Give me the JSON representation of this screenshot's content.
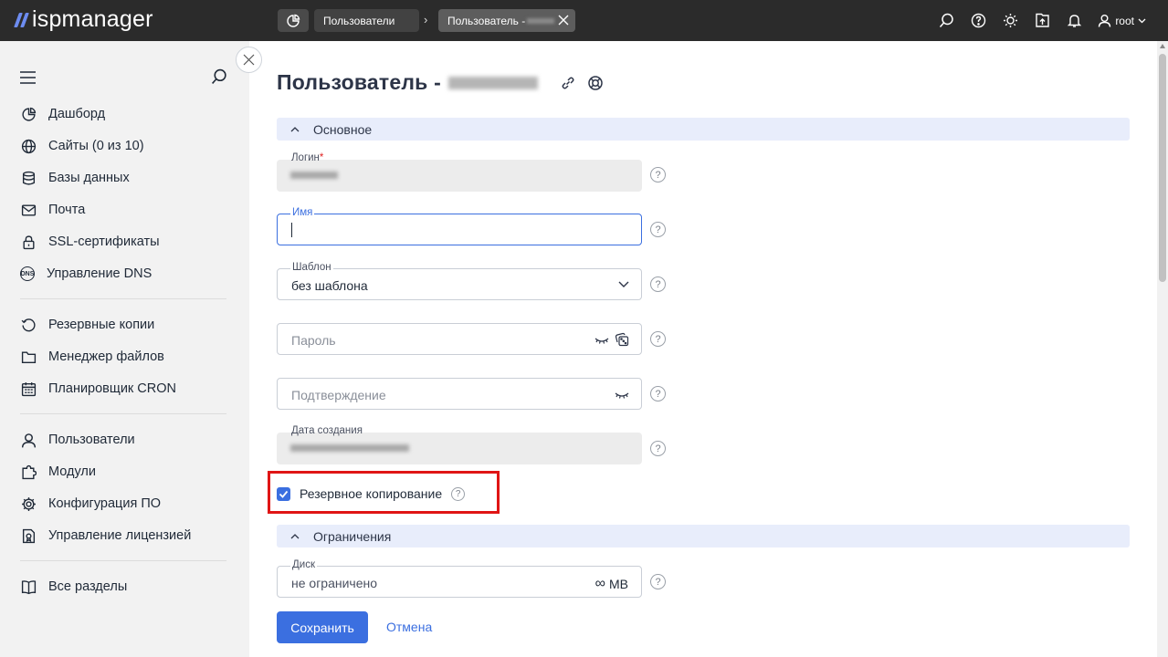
{
  "app": {
    "logo_text": "ispmanager",
    "accent": "#3b6fe0"
  },
  "topbar": {
    "tabs": [
      {
        "label": "Пользователи"
      },
      {
        "label": "Пользователь -"
      }
    ],
    "user_label": "root"
  },
  "sidebar": {
    "items": [
      {
        "label": "Дашборд",
        "icon": "dashboard-icon"
      },
      {
        "label": "Сайты (0 из 10)",
        "icon": "globe-icon"
      },
      {
        "label": "Базы данных",
        "icon": "database-icon"
      },
      {
        "label": "Почта",
        "icon": "mail-icon"
      },
      {
        "label": "SSL-сертификаты",
        "icon": "lock-icon"
      },
      {
        "label": "Управление DNS",
        "icon": "dns-icon"
      },
      {
        "label": "Резервные копии",
        "icon": "backup-icon"
      },
      {
        "label": "Менеджер файлов",
        "icon": "folder-icon"
      },
      {
        "label": "Планировщик CRON",
        "icon": "calendar-icon"
      },
      {
        "label": "Пользователи",
        "icon": "user-icon"
      },
      {
        "label": "Модули",
        "icon": "puzzle-icon"
      },
      {
        "label": "Конфигурация ПО",
        "icon": "gear-icon"
      },
      {
        "label": "Управление лицензией",
        "icon": "license-icon"
      },
      {
        "label": "Все разделы",
        "icon": "book-icon"
      }
    ],
    "dns_icon_text": "DNS"
  },
  "main": {
    "title": "Пользователь -",
    "sections": {
      "basic": "Основное",
      "limits": "Ограничения"
    },
    "fields": {
      "login": {
        "label": "Логин",
        "required_mark": "*"
      },
      "name": {
        "label": "Имя",
        "value": ""
      },
      "template": {
        "label": "Шаблон",
        "value": "без шаблона"
      },
      "password": {
        "placeholder": "Пароль"
      },
      "confirm": {
        "placeholder": "Подтверждение"
      },
      "created": {
        "label": "Дата создания"
      },
      "disk": {
        "label": "Диск",
        "value": "не ограничено",
        "unit": "MB",
        "unlimited_symbol": "∞"
      }
    },
    "backup_checkbox": {
      "label": "Резервное копирование",
      "checked": true
    },
    "help_symbol": "?",
    "buttons": {
      "save": "Сохранить",
      "cancel": "Отмена"
    }
  }
}
